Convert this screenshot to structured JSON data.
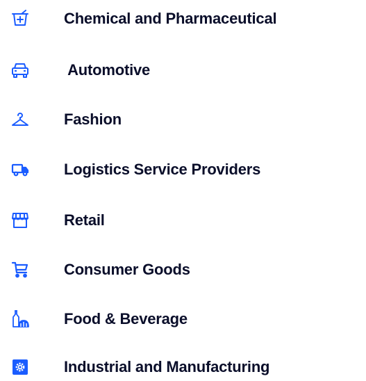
{
  "colors": {
    "icon": "#1a5cff",
    "text": "#0a0e2a"
  },
  "industries": [
    {
      "label": "Chemical and Pharmaceutical",
      "icon": "mortar-pestle-icon"
    },
    {
      "label": " Automotive",
      "icon": "car-icon"
    },
    {
      "label": "Fashion",
      "icon": "hanger-icon"
    },
    {
      "label": "Logistics Service Providers",
      "icon": "truck-icon"
    },
    {
      "label": "Retail",
      "icon": "storefront-icon"
    },
    {
      "label": "Consumer Goods",
      "icon": "shopping-cart-icon"
    },
    {
      "label": "Food & Beverage",
      "icon": "bottle-bread-icon"
    },
    {
      "label": "Industrial and Manufacturing",
      "icon": "gear-box-icon"
    }
  ]
}
